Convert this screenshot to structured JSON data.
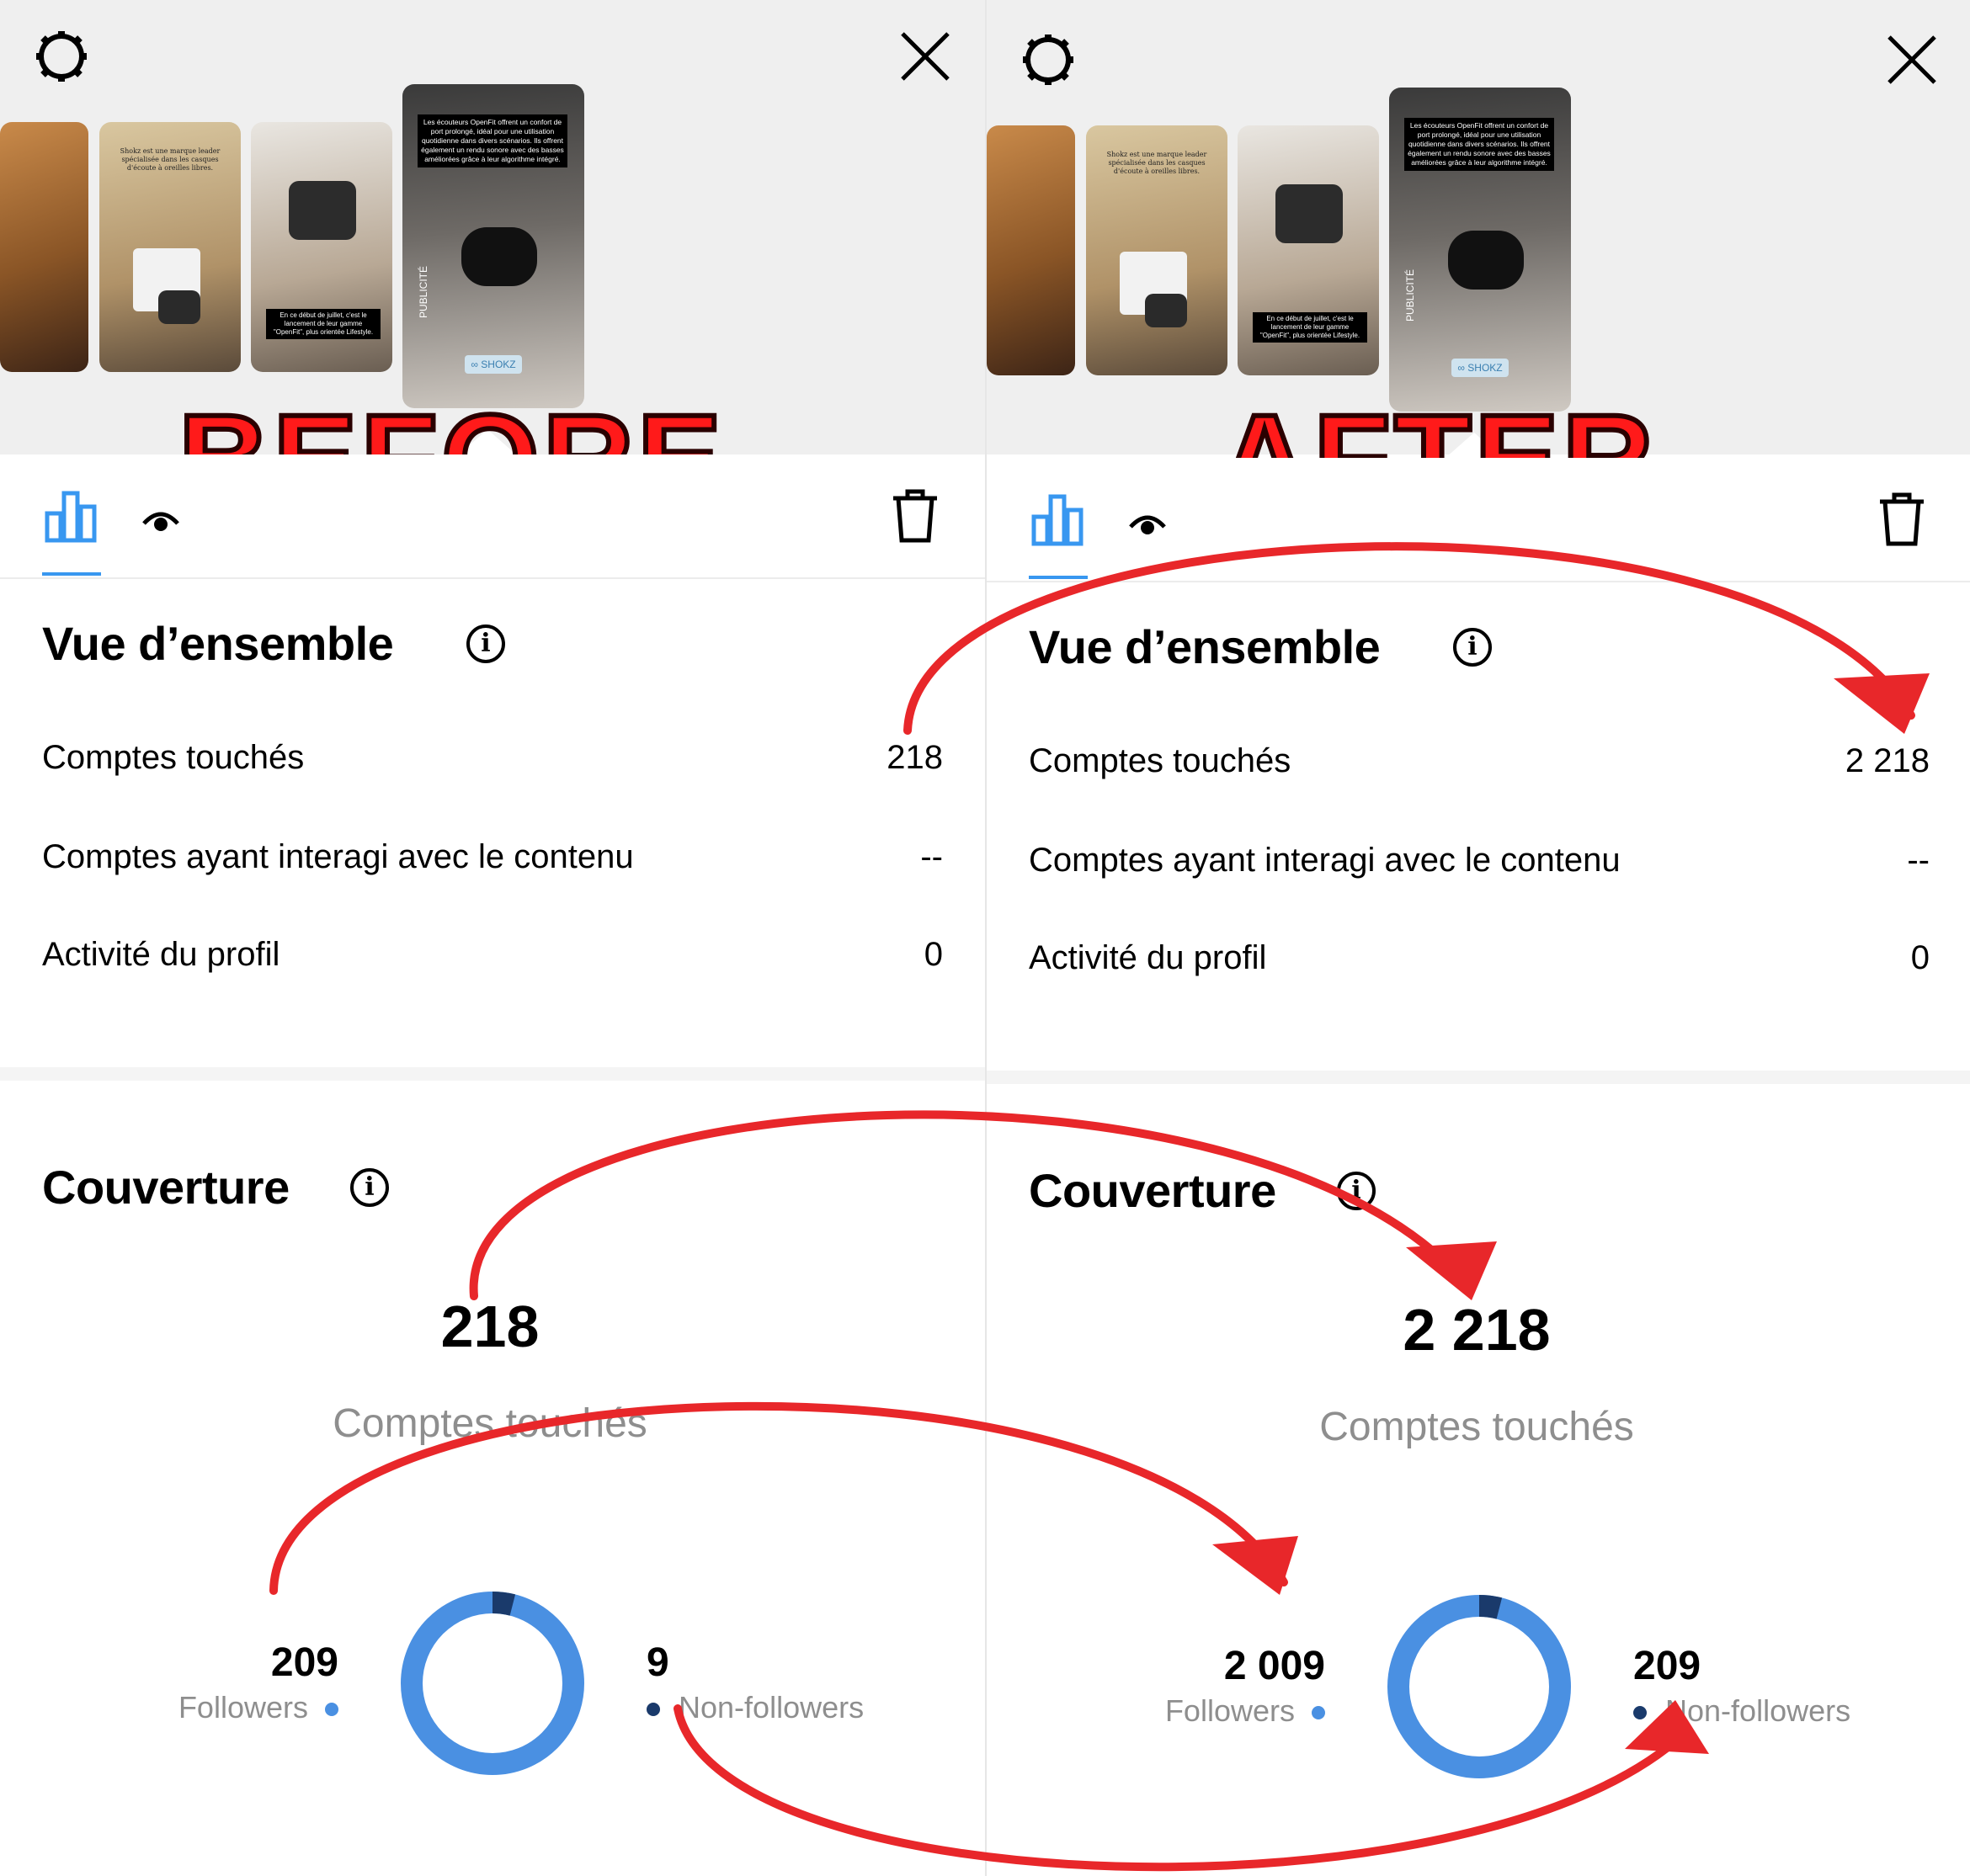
{
  "before": {
    "label": "BEFORE",
    "overview": {
      "title": "Vue d’ensemble",
      "rows": [
        {
          "label": "Comptes touchés",
          "value": "218"
        },
        {
          "label": "Comptes ayant interagi avec le contenu",
          "value": "--"
        },
        {
          "label": "Activité du profil",
          "value": "0"
        }
      ]
    },
    "coverage": {
      "title": "Couverture",
      "total": "218",
      "total_label": "Comptes touchés",
      "followers": {
        "value": "209",
        "label": "Followers"
      },
      "non_followers": {
        "value": "9",
        "label": "Non-followers"
      },
      "non_followers_share": 0.04
    }
  },
  "after": {
    "label": "AFTER",
    "overview": {
      "title": "Vue d’ensemble",
      "rows": [
        {
          "label": "Comptes touchés",
          "value": "2 218"
        },
        {
          "label": "Comptes ayant interagi avec le contenu",
          "value": "--"
        },
        {
          "label": "Activité du profil",
          "value": "0"
        }
      ]
    },
    "coverage": {
      "title": "Couverture",
      "total": "2 218",
      "total_label": "Comptes touchés",
      "followers": {
        "value": "2 009",
        "label": "Followers"
      },
      "non_followers": {
        "value": "209",
        "label": "Non-followers"
      },
      "non_followers_share": 0.04
    }
  },
  "story_thumbnails": {
    "thumb2_text": "Shokz est une marque leader spécialisée dans les casques d'écoute à oreilles libres.",
    "thumb3_text": "En ce début de juillet, c'est le lancement de leur gamme \"OpenFit\", plus orientée Lifestyle.",
    "thumb4_text": "Les écouteurs OpenFit offrent un confort de port prolongé, idéal pour une utilisation quotidienne dans divers scénarios. Ils offrent également un rendu sonore avec des basses améliorées grâce à leur algorithme intégré.",
    "thumb4_side": "PUBLICITÉ",
    "thumb4_brand": "SHOKZ"
  },
  "colors": {
    "accent_blue": "#3897f0",
    "followers_blue": "#4a90e2",
    "non_followers_navy": "#1a3a6b",
    "arrow_red": "#e8272a",
    "label_red": "#ff1a1a"
  }
}
